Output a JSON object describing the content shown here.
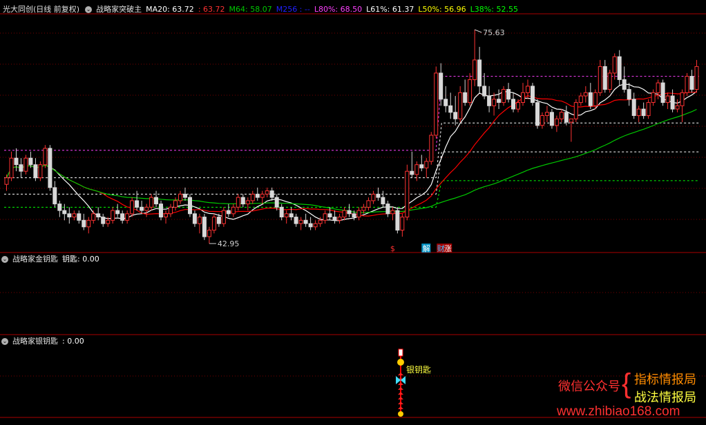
{
  "main_header": {
    "symbol": "光大同创(日线 前复权)",
    "indicator": "战略家突破主",
    "ma20_label": "MA20: 63.72",
    "val2": ": 63.72",
    "m64_label": "M64: 58.07",
    "m256_label": "M256 : --",
    "l80_label": "L80%: 68.50",
    "l61_label": "L61%: 61.37",
    "l50_label": "L50%: 56.96",
    "l38_label": "L38%: 52.55"
  },
  "panel2_header": {
    "title": "战略家金钥匙",
    "value": "钥匙: 0.00"
  },
  "panel3_header": {
    "title": "战略家银钥匙",
    "value": ": 0.00"
  },
  "watermark": {
    "wechat": "微信公众号",
    "brand1": "指标情报局",
    "brand2": "战法情报局",
    "site": "www.zhibiao168.com"
  },
  "colors": {
    "up": "#ff3232",
    "down": "#d8d8d8",
    "ma20": "#ff0000",
    "m64": "#00c800",
    "white_line": "#ffffff",
    "l80": "#ff40ff",
    "l61": "#ffffff",
    "l50": "#ffff00",
    "l38": "#00ff00",
    "separator": "#aa0000"
  },
  "chart_data": {
    "type": "candlestick",
    "price_high_label": "75.63",
    "price_low_label": "42.95",
    "ylim": [
      42.0,
      77.0
    ],
    "levels": {
      "l80": 68.5,
      "l61": 61.37,
      "l50": 56.96,
      "l38": 52.55
    },
    "signals": {
      "dollar": "$",
      "jie": "解",
      "cai": "财",
      "zhang": "涨"
    },
    "panel3_annotation": "银钥匙",
    "ohlc": [
      [
        52.0,
        53.5,
        51.0,
        53.0
      ],
      [
        53.0,
        57.0,
        52.5,
        56.0
      ],
      [
        56.0,
        57.5,
        54.0,
        55.0
      ],
      [
        55.0,
        56.0,
        53.0,
        54.0
      ],
      [
        54.0,
        56.5,
        53.5,
        56.0
      ],
      [
        56.0,
        57.0,
        54.5,
        55.0
      ],
      [
        55.0,
        56.0,
        52.5,
        53.0
      ],
      [
        53.0,
        55.5,
        52.5,
        55.0
      ],
      [
        55.0,
        58.0,
        54.5,
        57.5
      ],
      [
        57.5,
        58.0,
        51.0,
        51.5
      ],
      [
        51.5,
        52.5,
        48.5,
        49.0
      ],
      [
        49.0,
        49.5,
        47.0,
        48.0
      ],
      [
        48.0,
        49.0,
        46.5,
        47.5
      ],
      [
        47.5,
        48.5,
        46.0,
        47.0
      ],
      [
        47.0,
        48.0,
        46.5,
        47.5
      ],
      [
        47.5,
        48.0,
        46.0,
        46.5
      ],
      [
        46.5,
        47.5,
        45.0,
        45.5
      ],
      [
        45.5,
        47.0,
        44.5,
        46.5
      ],
      [
        46.5,
        48.0,
        46.0,
        47.5
      ],
      [
        47.5,
        48.5,
        46.5,
        47.0
      ],
      [
        47.0,
        47.5,
        45.5,
        46.0
      ],
      [
        46.0,
        47.0,
        45.5,
        46.5
      ],
      [
        46.5,
        48.5,
        46.0,
        48.0
      ],
      [
        48.0,
        49.0,
        47.0,
        47.5
      ],
      [
        47.5,
        48.0,
        46.0,
        46.5
      ],
      [
        46.5,
        48.0,
        46.0,
        47.5
      ],
      [
        47.5,
        50.0,
        47.0,
        49.5
      ],
      [
        49.5,
        51.0,
        48.0,
        48.5
      ],
      [
        48.5,
        49.5,
        47.5,
        48.0
      ],
      [
        48.0,
        49.0,
        47.0,
        48.5
      ],
      [
        48.5,
        50.5,
        48.0,
        50.0
      ],
      [
        50.0,
        51.0,
        48.5,
        49.0
      ],
      [
        49.0,
        49.5,
        46.5,
        47.0
      ],
      [
        47.0,
        48.0,
        46.0,
        47.5
      ],
      [
        47.5,
        49.0,
        47.0,
        48.5
      ],
      [
        48.5,
        50.0,
        48.0,
        49.5
      ],
      [
        49.5,
        51.0,
        49.0,
        50.5
      ],
      [
        50.5,
        51.5,
        49.5,
        50.0
      ],
      [
        50.0,
        50.5,
        47.0,
        47.5
      ],
      [
        47.5,
        48.0,
        45.5,
        46.0
      ],
      [
        46.0,
        47.5,
        44.5,
        47.0
      ],
      [
        47.0,
        47.5,
        43.5,
        44.0
      ],
      [
        44.0,
        45.5,
        42.95,
        45.0
      ],
      [
        45.0,
        47.5,
        44.5,
        47.0
      ],
      [
        47.0,
        47.5,
        45.5,
        46.0
      ],
      [
        46.0,
        48.5,
        45.5,
        48.0
      ],
      [
        48.0,
        49.0,
        47.0,
        47.5
      ],
      [
        47.5,
        49.0,
        47.0,
        48.5
      ],
      [
        48.5,
        50.5,
        48.0,
        50.0
      ],
      [
        50.0,
        50.5,
        48.5,
        49.0
      ],
      [
        49.0,
        50.0,
        48.0,
        49.5
      ],
      [
        49.5,
        51.0,
        49.0,
        50.5
      ],
      [
        50.5,
        51.5,
        49.5,
        50.0
      ],
      [
        50.0,
        51.0,
        49.0,
        50.5
      ],
      [
        50.5,
        51.5,
        50.0,
        51.0
      ],
      [
        51.0,
        51.5,
        49.5,
        50.0
      ],
      [
        50.0,
        50.5,
        48.0,
        48.5
      ],
      [
        48.5,
        49.0,
        46.5,
        47.0
      ],
      [
        47.0,
        48.0,
        46.0,
        47.5
      ],
      [
        47.5,
        48.5,
        46.5,
        47.0
      ],
      [
        47.0,
        47.5,
        45.5,
        46.0
      ],
      [
        46.0,
        47.0,
        45.0,
        46.5
      ],
      [
        46.5,
        47.5,
        45.5,
        46.0
      ],
      [
        46.0,
        47.0,
        45.0,
        45.5
      ],
      [
        45.5,
        46.5,
        45.0,
        46.0
      ],
      [
        46.0,
        47.0,
        45.5,
        46.5
      ],
      [
        46.5,
        48.0,
        46.0,
        47.5
      ],
      [
        47.5,
        48.5,
        46.5,
        47.0
      ],
      [
        47.0,
        48.0,
        46.0,
        46.5
      ],
      [
        46.5,
        47.5,
        46.0,
        47.0
      ],
      [
        47.0,
        48.5,
        46.5,
        48.0
      ],
      [
        48.0,
        49.0,
        47.0,
        47.5
      ],
      [
        47.5,
        48.0,
        46.5,
        47.0
      ],
      [
        47.0,
        48.5,
        46.5,
        48.0
      ],
      [
        48.0,
        49.0,
        47.5,
        48.5
      ],
      [
        48.5,
        50.0,
        48.0,
        49.5
      ],
      [
        49.5,
        51.0,
        49.0,
        50.5
      ],
      [
        50.5,
        51.5,
        49.5,
        50.0
      ],
      [
        50.0,
        51.0,
        48.5,
        49.0
      ],
      [
        49.0,
        49.5,
        47.0,
        47.5
      ],
      [
        47.5,
        48.5,
        46.5,
        48.0
      ],
      [
        48.0,
        48.5,
        44.5,
        45.0
      ],
      [
        45.0,
        47.5,
        44.0,
        47.0
      ],
      [
        47.0,
        55.0,
        46.5,
        54.0
      ],
      [
        54.0,
        57.0,
        53.0,
        53.5
      ],
      [
        53.5,
        55.5,
        52.5,
        55.0
      ],
      [
        55.0,
        56.5,
        54.0,
        54.5
      ],
      [
        54.5,
        56.0,
        53.0,
        55.5
      ],
      [
        55.5,
        60.0,
        55.0,
        59.5
      ],
      [
        59.5,
        70.0,
        59.0,
        69.0
      ],
      [
        69.0,
        70.5,
        64.0,
        65.0
      ],
      [
        65.0,
        67.0,
        63.0,
        64.0
      ],
      [
        64.0,
        66.0,
        62.0,
        63.0
      ],
      [
        63.0,
        65.5,
        61.0,
        62.0
      ],
      [
        62.0,
        67.0,
        61.5,
        66.0
      ],
      [
        66.0,
        68.0,
        64.0,
        64.5
      ],
      [
        64.5,
        69.0,
        64.0,
        68.0
      ],
      [
        68.0,
        75.63,
        67.0,
        71.0
      ],
      [
        71.0,
        73.0,
        66.0,
        67.0
      ],
      [
        67.0,
        69.0,
        65.0,
        65.5
      ],
      [
        65.5,
        67.0,
        63.0,
        64.0
      ],
      [
        64.0,
        66.0,
        62.5,
        65.0
      ],
      [
        65.0,
        66.5,
        63.5,
        64.5
      ],
      [
        64.5,
        67.0,
        64.0,
        66.5
      ],
      [
        66.5,
        67.5,
        64.5,
        65.0
      ],
      [
        65.0,
        66.0,
        63.0,
        63.5
      ],
      [
        63.5,
        65.0,
        63.0,
        64.5
      ],
      [
        64.5,
        67.5,
        64.0,
        66.0
      ],
      [
        66.0,
        68.0,
        65.0,
        67.0
      ],
      [
        67.0,
        67.5,
        64.0,
        64.5
      ],
      [
        64.5,
        65.0,
        60.5,
        61.0
      ],
      [
        61.0,
        63.0,
        60.5,
        62.5
      ],
      [
        62.5,
        64.0,
        61.5,
        63.0
      ],
      [
        63.0,
        63.5,
        60.5,
        61.0
      ],
      [
        61.0,
        62.5,
        60.0,
        62.0
      ],
      [
        62.0,
        63.5,
        61.5,
        63.0
      ],
      [
        63.0,
        64.0,
        61.0,
        61.5
      ],
      [
        61.5,
        62.0,
        58.5,
        62.0
      ],
      [
        62.0,
        65.0,
        61.5,
        64.5
      ],
      [
        64.5,
        66.0,
        64.0,
        65.5
      ],
      [
        65.5,
        67.0,
        64.5,
        66.0
      ],
      [
        66.0,
        67.5,
        63.5,
        64.0
      ],
      [
        64.0,
        66.5,
        63.5,
        66.0
      ],
      [
        66.0,
        71.0,
        65.5,
        70.0
      ],
      [
        70.0,
        71.0,
        66.0,
        66.5
      ],
      [
        66.5,
        69.5,
        66.0,
        69.0
      ],
      [
        69.0,
        72.0,
        68.0,
        71.5
      ],
      [
        71.5,
        72.5,
        67.0,
        68.0
      ],
      [
        68.0,
        70.0,
        66.0,
        66.5
      ],
      [
        66.5,
        67.5,
        64.0,
        65.0
      ],
      [
        65.0,
        66.0,
        62.0,
        62.5
      ],
      [
        62.5,
        64.0,
        61.5,
        63.5
      ],
      [
        63.5,
        64.5,
        62.0,
        62.5
      ],
      [
        62.5,
        65.0,
        62.0,
        64.5
      ],
      [
        64.5,
        66.5,
        64.0,
        66.0
      ],
      [
        66.0,
        68.0,
        65.0,
        67.5
      ],
      [
        67.5,
        68.0,
        64.0,
        64.5
      ],
      [
        64.5,
        66.0,
        63.5,
        65.5
      ],
      [
        65.5,
        66.5,
        63.0,
        63.5
      ],
      [
        63.5,
        65.0,
        63.0,
        64.0
      ],
      [
        64.0,
        66.5,
        61.5,
        66.0
      ],
      [
        66.0,
        69.0,
        65.5,
        68.5
      ],
      [
        68.5,
        69.5,
        66.0,
        66.5
      ],
      [
        66.5,
        71.0,
        66.0,
        70.0
      ]
    ]
  }
}
